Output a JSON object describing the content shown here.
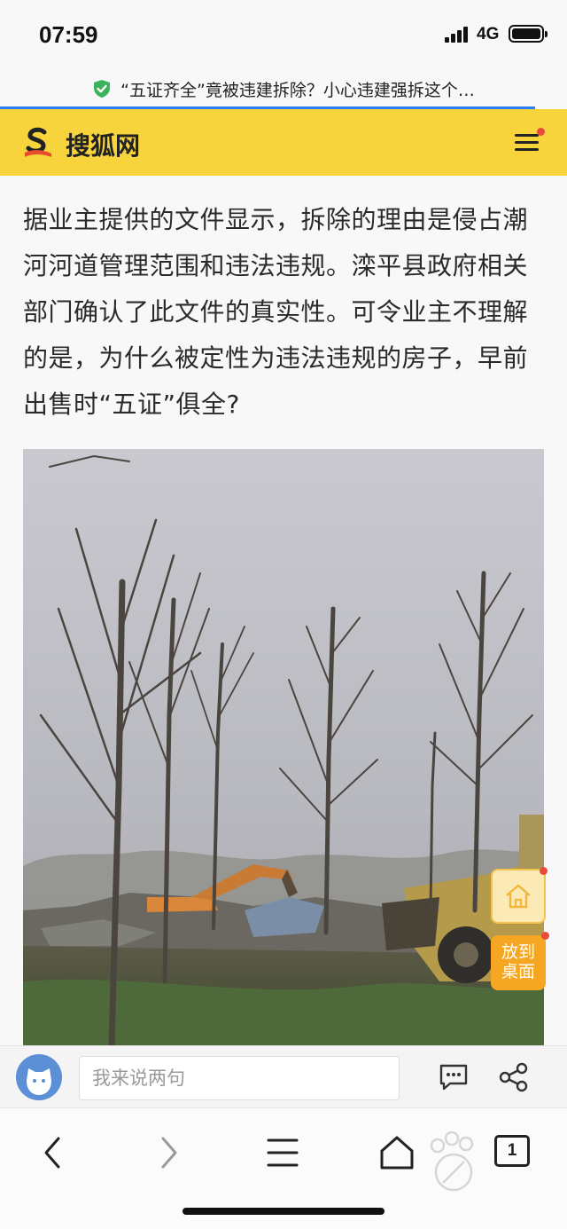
{
  "status": {
    "time": "07:59",
    "network": "4G"
  },
  "url_bar": {
    "title": "“五证齐全”竟被违建拆除？小心违建强拆这个…"
  },
  "site": {
    "name": "搜狐网",
    "accent": "#f7d43c"
  },
  "article": {
    "paragraph": "据业主提供的文件显示，拆除的理由是侵占潮河河道管理范围和违法违规。滦平县政府相关部门确认了此文件的真实性。可令业主不理解的是，为什么被定性为违法违规的房子，早前出售时“五证”俱全?"
  },
  "floating": {
    "home_icon": "home-icon",
    "desktop_label_1": "放到",
    "desktop_label_2": "桌面"
  },
  "comment_bar": {
    "placeholder": "我来说两句"
  },
  "toolbar": {
    "tabs_count": "1"
  },
  "icons": [
    "shield-check-icon",
    "sohu-logo-icon",
    "menu-icon",
    "home-icon",
    "comment-icon",
    "share-icon",
    "back-icon",
    "forward-icon",
    "list-icon",
    "browser-home-icon",
    "tabs-icon"
  ]
}
